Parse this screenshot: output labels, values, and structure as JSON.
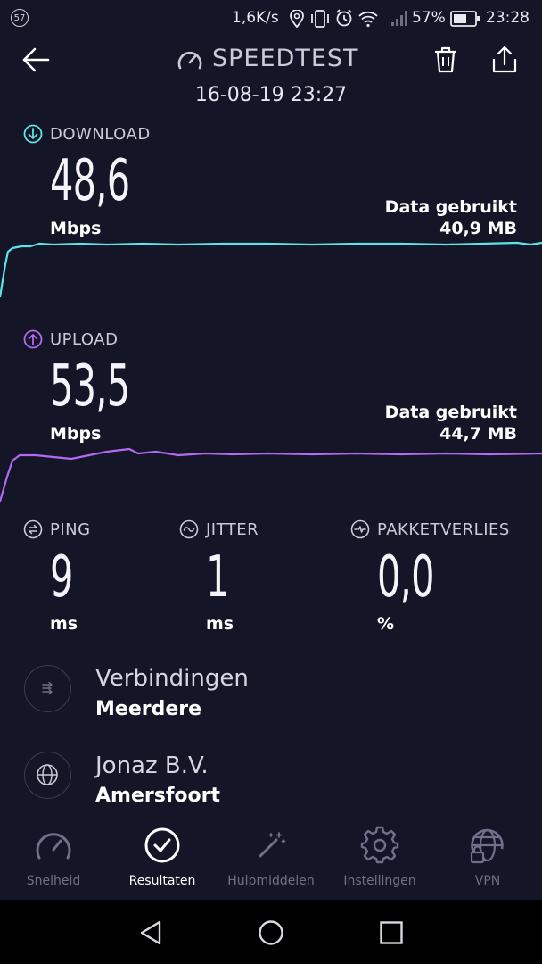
{
  "status_bar": {
    "notification_badge": "57",
    "network_speed": "1,6K/s",
    "battery": "57%",
    "time": "23:28"
  },
  "header": {
    "title": "SPEEDTEST",
    "date": "16-08-19 23:27"
  },
  "download": {
    "label": "DOWNLOAD",
    "value": "48,6",
    "unit": "Mbps",
    "data_used_label": "Data gebruikt",
    "data_used_value": "40,9 MB",
    "color": "#5ee3e6"
  },
  "upload": {
    "label": "UPLOAD",
    "value": "53,5",
    "unit": "Mbps",
    "data_used_label": "Data gebruikt",
    "data_used_value": "44,7 MB",
    "color": "#b469f0"
  },
  "metrics": [
    {
      "label": "PING",
      "value": "9",
      "unit": "ms"
    },
    {
      "label": "JITTER",
      "value": "1",
      "unit": "ms"
    },
    {
      "label": "PAKKETVERLIES",
      "value": "0,0",
      "unit": "%"
    }
  ],
  "connections": {
    "title": "Verbindingen",
    "value": "Meerdere"
  },
  "server": {
    "title": "Jonaz B.V.",
    "value": "Amersfoort"
  },
  "nav": [
    {
      "label": "Snelheid",
      "icon": "speedometer-icon"
    },
    {
      "label": "Resultaten",
      "icon": "check-circle-icon"
    },
    {
      "label": "Hulpmiddelen",
      "icon": "magic-wand-icon"
    },
    {
      "label": "Instellingen",
      "icon": "gear-icon"
    },
    {
      "label": "VPN",
      "icon": "globe-lock-icon"
    }
  ]
}
